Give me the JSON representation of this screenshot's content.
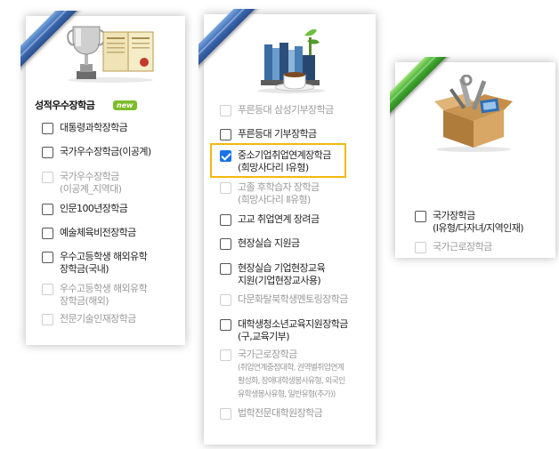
{
  "colors": {
    "ribbon_blue": "#3f6fb8",
    "ribbon_green": "#49b435",
    "highlight": "#f2b90f",
    "new_badge": "#7cbd2a",
    "checked": "#1a73e8"
  },
  "panel1": {
    "title": "성적우수장학금",
    "badge": "new",
    "items": [
      {
        "label": "대통령과학장학금",
        "checked": false,
        "enabled": true
      },
      {
        "label": "국가우수장학금(이공계)",
        "checked": false,
        "enabled": true
      },
      {
        "label": "국가우수장학금",
        "label2": "(이공계_지역대)",
        "checked": false,
        "enabled": false
      },
      {
        "label": "인문100년장학금",
        "checked": false,
        "enabled": true
      },
      {
        "label": "예술체육비전장학금",
        "checked": false,
        "enabled": true
      },
      {
        "label": "우수고등학생 해외유학",
        "label2": "장학금(국내)",
        "checked": false,
        "enabled": true
      },
      {
        "label": "우수고등학생 해외유학",
        "label2": "장학금(해외)",
        "checked": false,
        "enabled": false
      },
      {
        "label": "전문기술인재장학금",
        "checked": false,
        "enabled": false
      }
    ]
  },
  "panel2": {
    "items": [
      {
        "label": "푸른등대 삼성기부장학금",
        "checked": false,
        "enabled": false
      },
      {
        "label": "푸른등대 기부장학금",
        "checked": false,
        "enabled": true
      },
      {
        "label": "중소기업취업연계장학금",
        "label2": "(희망사다리 Ⅰ유형)",
        "checked": true,
        "enabled": true
      },
      {
        "label": "고졸 후학습자 장학금",
        "label2": "(희망사다리 Ⅱ유형)",
        "checked": false,
        "enabled": false
      },
      {
        "label": "고교 취업연계 장려금",
        "checked": false,
        "enabled": true
      },
      {
        "label": "현장실습 지원금",
        "checked": false,
        "enabled": true
      },
      {
        "label": "현장실습 기업현장교육",
        "label2": "지원(기업현장교사용)",
        "checked": false,
        "enabled": true
      },
      {
        "label": "다문화탈북학생멘토링장학금",
        "checked": false,
        "enabled": false
      },
      {
        "label": "대학생청소년교육지원장학금",
        "label2": "(구,교육기부)",
        "checked": false,
        "enabled": true
      },
      {
        "label": "국가근로장학금",
        "label2": "(취업연계중점대학, 권역별취업연계",
        "label3": "활성화, 장애대학생봉사유형, 외국인",
        "label4": "유학생봉사유형, 일반유형(추가))",
        "checked": false,
        "enabled": false
      },
      {
        "label": "법학전문대학원장학금",
        "checked": false,
        "enabled": false
      }
    ]
  },
  "panel3": {
    "items": [
      {
        "label": "국가장학금",
        "label2": "(Ⅰ유형/다자녀/지역인재)",
        "checked": false,
        "enabled": true
      },
      {
        "label": "국가근로장학금",
        "checked": false,
        "enabled": false
      }
    ]
  },
  "icons": {
    "panel1": "trophy-and-certificate-icon",
    "panel2": "books-and-coffee-icon",
    "panel3": "toolbox-icon"
  }
}
